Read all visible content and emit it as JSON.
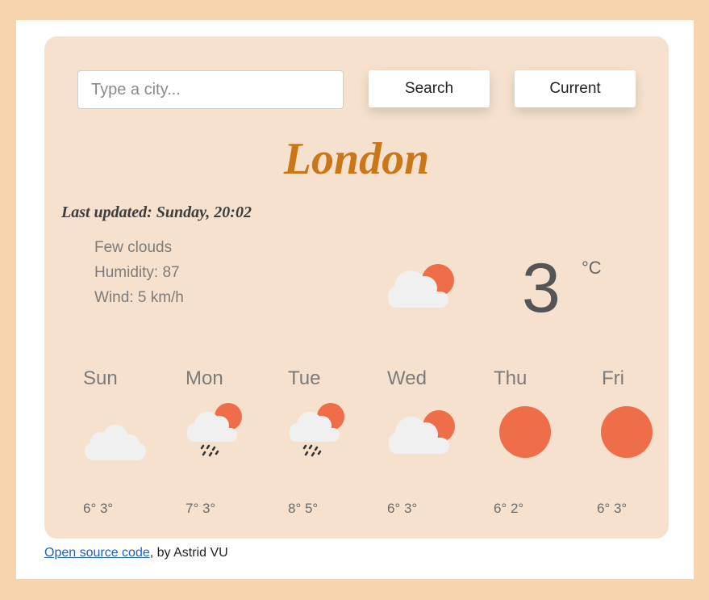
{
  "search": {
    "placeholder": "Type a city...",
    "search_label": "Search",
    "current_label": "Current"
  },
  "weather": {
    "city": "London",
    "last_updated": "Last updated: Sunday, 20:02",
    "description": "Few clouds",
    "humidity": "Humidity: 87",
    "wind": "Wind: 5 km/h",
    "temperature": "3",
    "unit": "°C",
    "icon": "few-clouds-icon"
  },
  "forecast": [
    {
      "day": "Sun",
      "temps": "6° 3°",
      "icon": "cloud-icon"
    },
    {
      "day": "Mon",
      "temps": "7° 3°",
      "icon": "rain-sun-cloud-icon"
    },
    {
      "day": "Tue",
      "temps": "8° 5°",
      "icon": "rain-sun-cloud-icon"
    },
    {
      "day": "Wed",
      "temps": "6° 3°",
      "icon": "few-clouds-icon"
    },
    {
      "day": "Thu",
      "temps": "6° 2°",
      "icon": "sun-icon"
    },
    {
      "day": "Fri",
      "temps": "6° 3°",
      "icon": "sun-icon"
    }
  ],
  "footer": {
    "link_text": "Open source code",
    "suffix": ", by Astrid VU"
  },
  "colors": {
    "page_bg": "#f7d4ad",
    "card_bg": "#f5e1cd",
    "city": "#c97719",
    "sun": "#ee6e4a",
    "cloud": "#f0f0f0",
    "link": "#1f5fbf"
  }
}
